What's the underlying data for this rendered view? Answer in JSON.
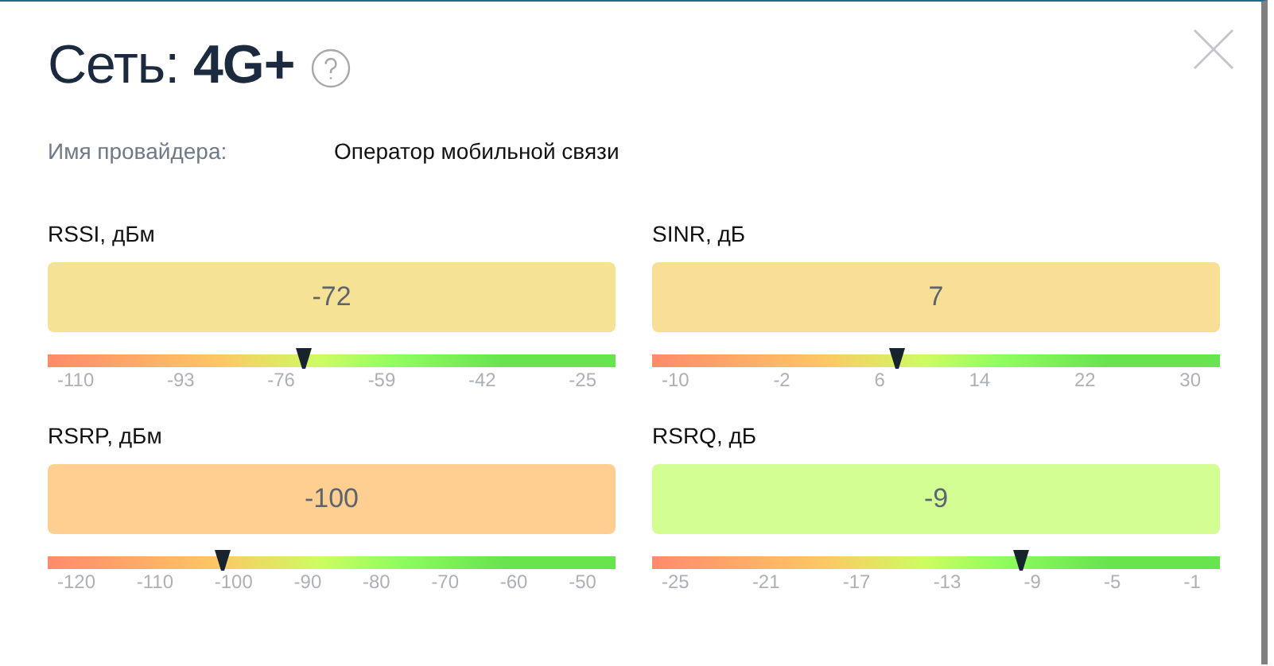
{
  "title": {
    "label": "Сеть:",
    "value": "4G+"
  },
  "provider": {
    "label": "Имя провайдера:",
    "value": "Оператор мобильной связи"
  },
  "meters": [
    {
      "name": "RSSI, дБм",
      "reading": "-72",
      "color": "#f5e295",
      "level": 0.451,
      "ticks": [
        "-110",
        "-93",
        "-76",
        "-59",
        "-42",
        "-25"
      ]
    },
    {
      "name": "SINR, дБ",
      "reading": "7",
      "color": "#f9df95",
      "level": 0.431,
      "ticks": [
        "-10",
        "-2",
        "6",
        "14",
        "22",
        "30"
      ]
    },
    {
      "name": "RSRP, дБм",
      "reading": "-100",
      "color": "#fecf91",
      "level": 0.308,
      "ticks": [
        "-120",
        "-110",
        "-100",
        "-90",
        "-80",
        "-70",
        "-60",
        "-50"
      ]
    },
    {
      "name": "RSRQ, дБ",
      "reading": "-9",
      "color": "#d2fe94",
      "level": 0.65,
      "ticks": [
        "-25",
        "-21",
        "-17",
        "-13",
        "-9",
        "-5",
        "-1"
      ]
    }
  ]
}
